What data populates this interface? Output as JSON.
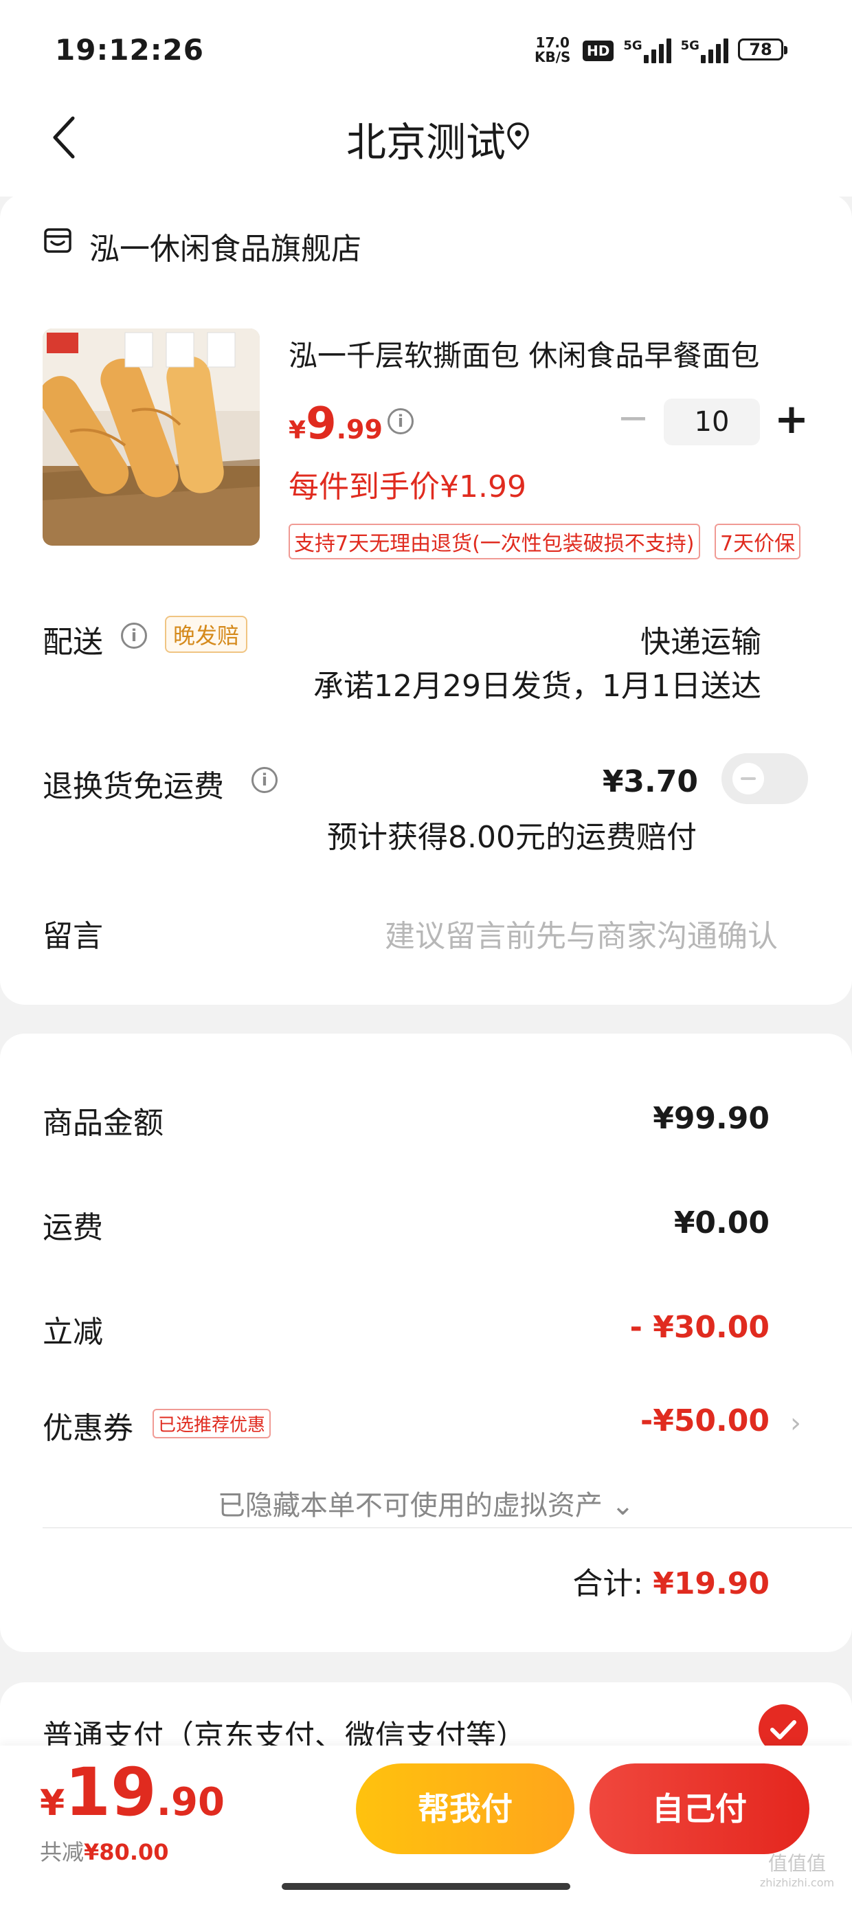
{
  "status_bar": {
    "time": "19:12:26",
    "net_speed_value": "17.0",
    "net_speed_unit": "KB/S",
    "hd_label": "HD",
    "net1_label": "5G",
    "net2_label": "5G",
    "battery": "78"
  },
  "nav": {
    "title": "北京测试",
    "back_icon": "chevron-left-icon",
    "location_icon": "location-pin-icon"
  },
  "store": {
    "icon": "store-icon",
    "name": "泓一休闲食品旗舰店"
  },
  "product": {
    "title": "泓一千层软撕面包 休闲食品早餐面包",
    "currency": "¥",
    "price_int": "9",
    "price_dec": ".99",
    "unit_price": "每件到手价¥1.99",
    "quantity": "10",
    "qty_minus": "−",
    "qty_plus": "+",
    "tags": [
      "支持7天无理由退货(一次性包装破损不支持)",
      "7天价保"
    ]
  },
  "delivery": {
    "label": "配送",
    "badge": "晚发赔",
    "method": "快递运输",
    "promise": "承诺12月29日发货，1月1日送达"
  },
  "return_shipping": {
    "label": "退换货免运费",
    "price": "¥3.70",
    "note": "预计获得8.00元的运费赔付",
    "enabled": false
  },
  "message": {
    "label": "留言",
    "placeholder": "建议留言前先与商家沟通确认"
  },
  "summary": {
    "goods_label": "商品金额",
    "goods_value": "¥99.90",
    "shipping_label": "运费",
    "shipping_value": "¥0.00",
    "discount_label": "立减",
    "discount_value": "- ¥30.00",
    "coupon_label": "优惠券",
    "coupon_tag": "已选推荐优惠",
    "coupon_value": "-¥50.00",
    "hidden_assets": "已隐藏本单不可使用的虚拟资产 ⌄",
    "total_label": "合计: ",
    "total_value": "¥19.90"
  },
  "payment": {
    "label": "普通支付（京东支付、微信支付等）",
    "selected": true
  },
  "bottom": {
    "currency": "¥",
    "price_int": "19",
    "price_dec": ".90",
    "saved_label": "共减",
    "saved_value": "¥80.00",
    "help_pay": "帮我付",
    "self_pay": "自己付"
  },
  "watermark": {
    "text": "值值值",
    "sub": "zhizhizhi.com"
  },
  "colors": {
    "accent_red": "#e02b1f",
    "help_pay_yellow": "#ffb414",
    "late_badge_orange": "#d58a1c"
  }
}
